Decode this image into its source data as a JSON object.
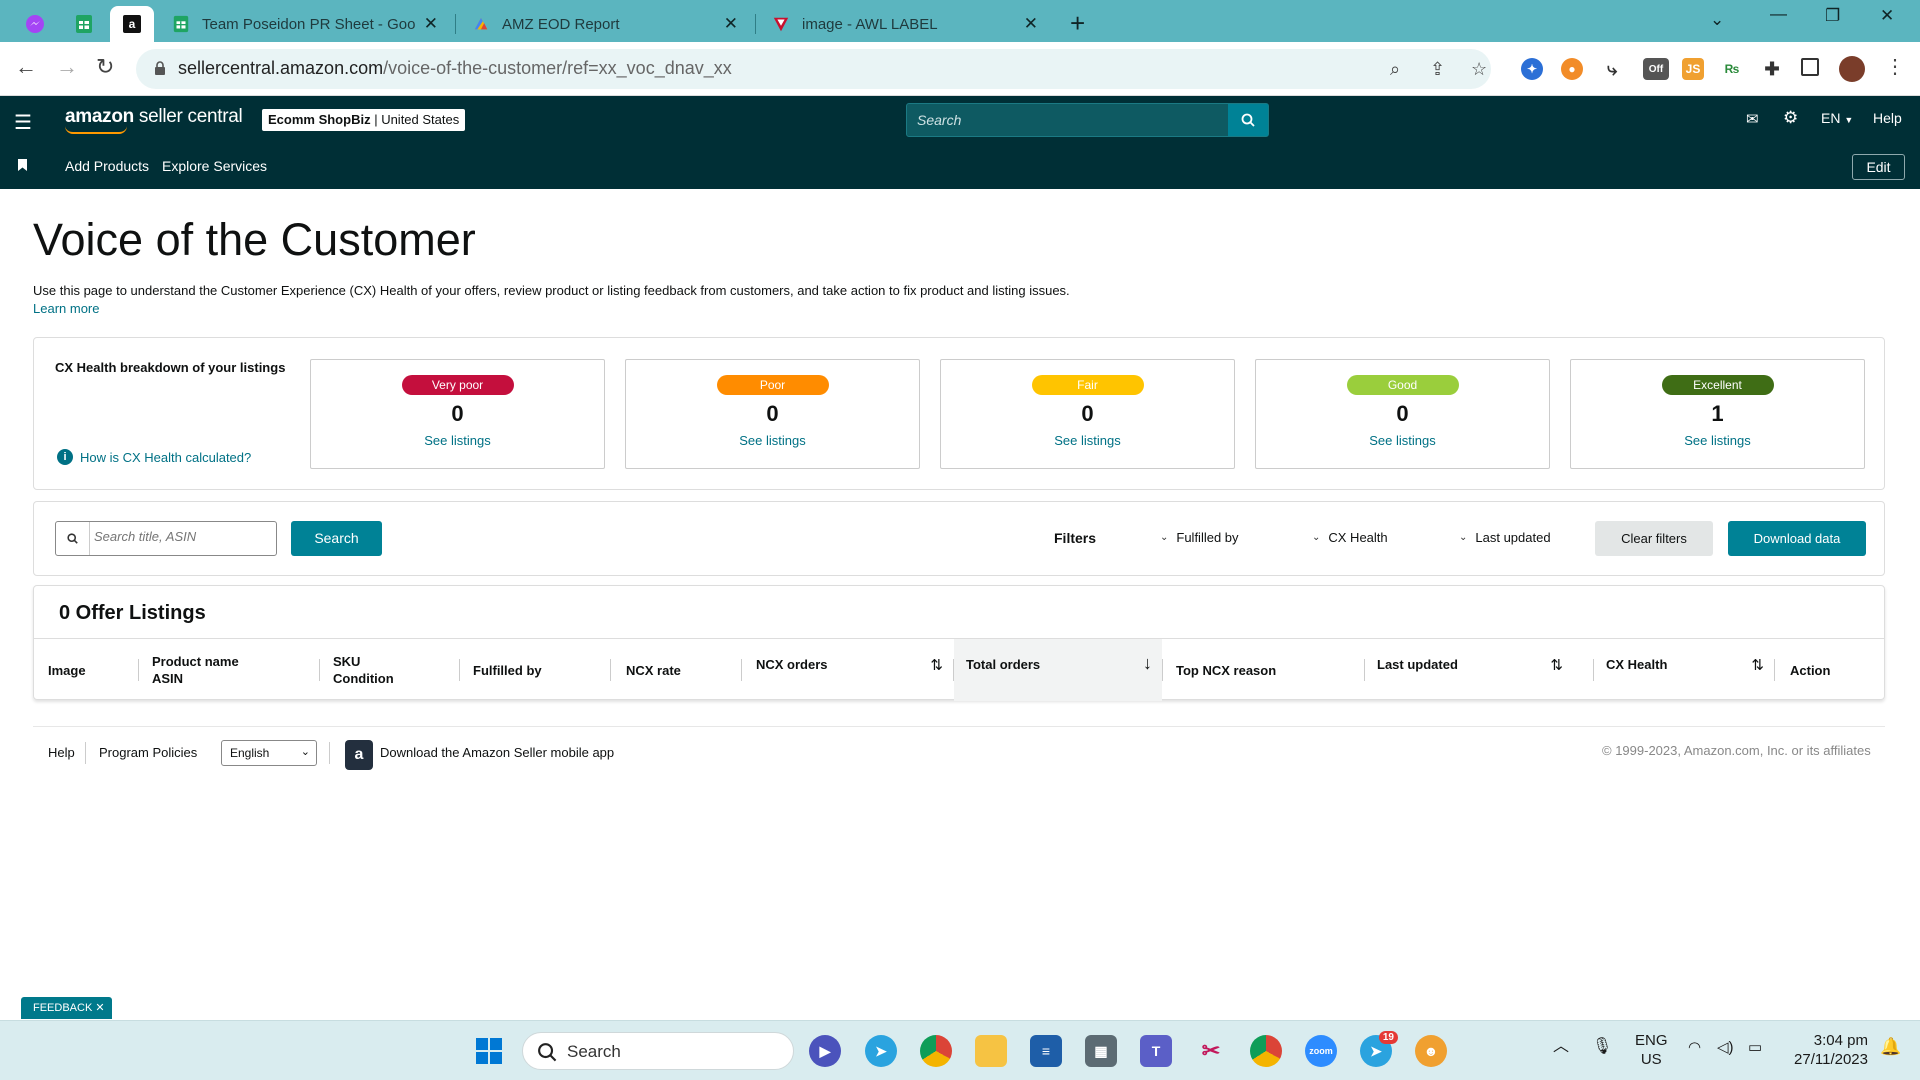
{
  "browser": {
    "tabs": [
      {
        "title": "Team Poseidon PR Sheet - Goog"
      },
      {
        "title": "AMZ EOD Report"
      },
      {
        "title": "image - AWL LABEL"
      }
    ],
    "url_host": "sellercentral.amazon.com",
    "url_path": "/voice-of-the-customer/ref=xx_voc_dnav_xx",
    "ext_off_label": "Off",
    "ext_js_label": "JS"
  },
  "header": {
    "logo_main": "amazon",
    "logo_rest": " seller central",
    "account_name": "Ecomm ShopBiz",
    "account_sep": " | ",
    "account_region": "United States",
    "search_placeholder": "Search",
    "lang": "EN",
    "help": "Help"
  },
  "subnav": {
    "links": [
      "Add Products",
      "Explore Services"
    ],
    "edit": "Edit"
  },
  "page": {
    "title": "Voice of the Customer",
    "description": "Use this page to understand the Customer Experience (CX) Health of your offers, review product or listing feedback from customers, and take action to fix product and listing issues.",
    "learn_more": "Learn more"
  },
  "cx_health": {
    "title": "CX Health breakdown of your listings",
    "how_link": "How is CX Health calculated?",
    "cards": [
      {
        "label": "Very poor",
        "count": "0",
        "link": "See listings",
        "color": "#c40f3d"
      },
      {
        "label": "Poor",
        "count": "0",
        "link": "See listings",
        "color": "#ff8c00"
      },
      {
        "label": "Fair",
        "count": "0",
        "link": "See listings",
        "color": "#ffc400"
      },
      {
        "label": "Good",
        "count": "0",
        "link": "See listings",
        "color": "#9ace3c"
      },
      {
        "label": "Excellent",
        "count": "1",
        "link": "See listings",
        "color": "#3f6d15"
      }
    ]
  },
  "filters": {
    "search_placeholder": "Search title, ASIN",
    "search_button": "Search",
    "label": "Filters",
    "dropdowns": [
      "Fulfilled by",
      "CX Health",
      "Last updated"
    ],
    "clear": "Clear filters",
    "download": "Download data"
  },
  "listings": {
    "title": "0 Offer Listings",
    "columns": [
      {
        "l1": "Image",
        "l2": ""
      },
      {
        "l1": "Product name",
        "l2": "ASIN"
      },
      {
        "l1": "SKU",
        "l2": "Condition"
      },
      {
        "l1": "Fulfilled by",
        "l2": ""
      },
      {
        "l1": "NCX rate",
        "l2": ""
      },
      {
        "l1": "NCX orders",
        "l2": ""
      },
      {
        "l1": "Total orders",
        "l2": ""
      },
      {
        "l1": "Top NCX reason",
        "l2": ""
      },
      {
        "l1": "Last updated",
        "l2": ""
      },
      {
        "l1": "CX Health",
        "l2": ""
      },
      {
        "l1": "Action",
        "l2": ""
      }
    ]
  },
  "footer": {
    "help": "Help",
    "policies": "Program Policies",
    "language": "English",
    "app_text": "Download the Amazon Seller mobile app",
    "copyright": "© 1999-2023, Amazon.com, Inc. or its affiliates",
    "feedback": "FEEDBACK"
  },
  "taskbar": {
    "search": "Search",
    "lang1": "ENG",
    "lang2": "US",
    "time": "3:04 pm",
    "date": "27/11/2023",
    "telegram_badge": "19"
  }
}
